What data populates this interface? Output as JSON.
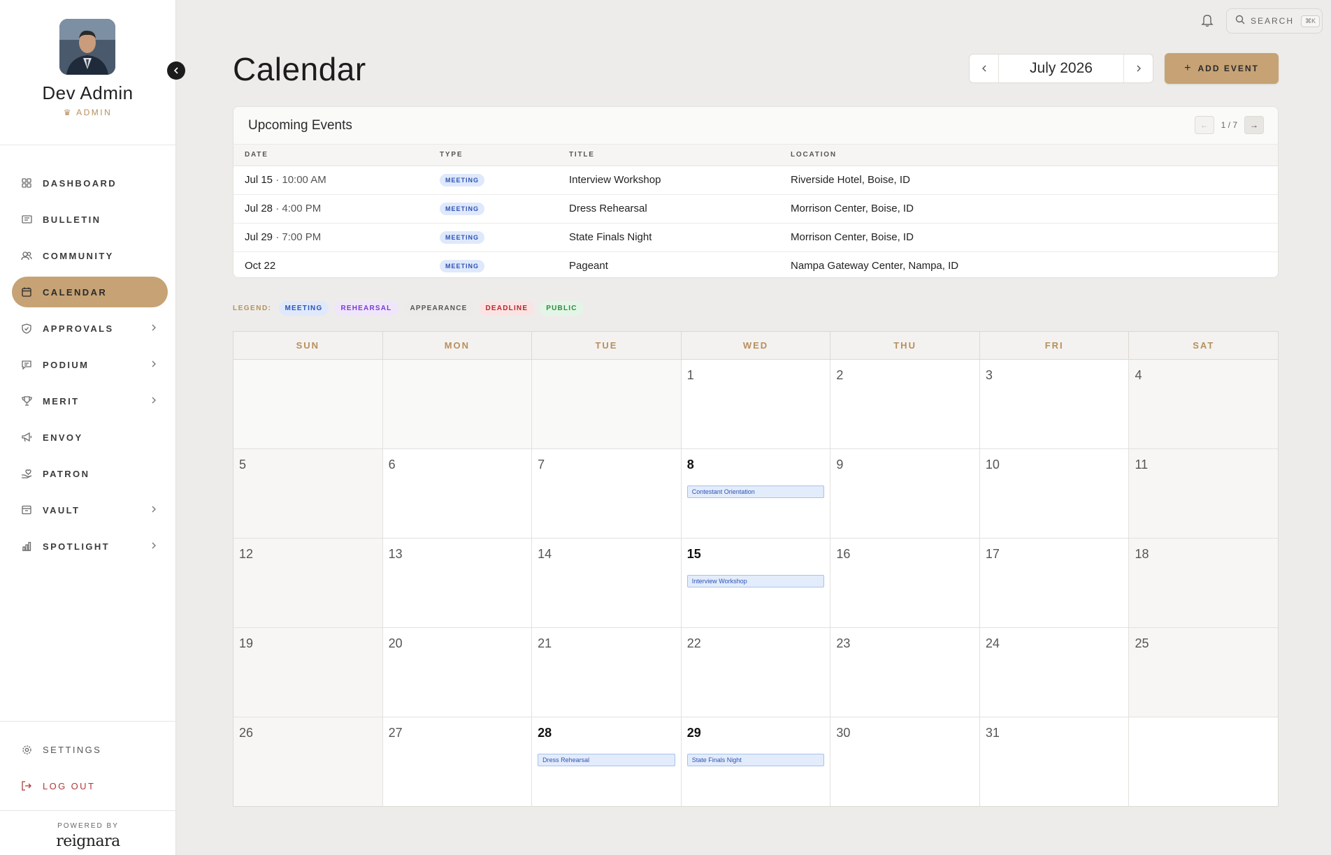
{
  "profile": {
    "name": "Dev Admin",
    "role": "ADMIN"
  },
  "nav": [
    {
      "label": "DASHBOARD",
      "icon": "grid-icon",
      "chevron": false,
      "active": false
    },
    {
      "label": "BULLETIN",
      "icon": "newspaper-icon",
      "chevron": false,
      "active": false
    },
    {
      "label": "COMMUNITY",
      "icon": "users-icon",
      "chevron": false,
      "active": false
    },
    {
      "label": "CALENDAR",
      "icon": "calendar-icon",
      "chevron": false,
      "active": true
    },
    {
      "label": "APPROVALS",
      "icon": "shield-check-icon",
      "chevron": true,
      "active": false
    },
    {
      "label": "PODIUM",
      "icon": "message-square-icon",
      "chevron": true,
      "active": false
    },
    {
      "label": "MERIT",
      "icon": "trophy-icon",
      "chevron": true,
      "active": false
    },
    {
      "label": "ENVOY",
      "icon": "megaphone-icon",
      "chevron": false,
      "active": false
    },
    {
      "label": "PATRON",
      "icon": "hand-heart-icon",
      "chevron": false,
      "active": false
    },
    {
      "label": "VAULT",
      "icon": "archive-icon",
      "chevron": true,
      "active": false
    },
    {
      "label": "SPOTLIGHT",
      "icon": "bar-chart-icon",
      "chevron": true,
      "active": false
    }
  ],
  "bottom_nav": {
    "settings": "SETTINGS",
    "logout": "LOG OUT"
  },
  "footer": {
    "powered_by": "POWERED BY",
    "brand": "reignara"
  },
  "topbar": {
    "search_label": "SEARCH",
    "search_shortcut": "⌘K"
  },
  "page_title": "Calendar",
  "month_label": "July 2026",
  "add_event_label": "ADD EVENT",
  "upcoming": {
    "title": "Upcoming Events",
    "pager": "1 / 7",
    "columns": [
      "DATE",
      "TYPE",
      "TITLE",
      "LOCATION"
    ],
    "rows": [
      {
        "date": "Jul 15",
        "time": " · 10:00 AM",
        "type": "MEETING",
        "title": "Interview Workshop",
        "location": "Riverside Hotel, Boise, ID"
      },
      {
        "date": "Jul 28",
        "time": " · 4:00 PM",
        "type": "MEETING",
        "title": "Dress Rehearsal",
        "location": "Morrison Center, Boise, ID"
      },
      {
        "date": "Jul 29",
        "time": " · 7:00 PM",
        "type": "MEETING",
        "title": "State Finals Night",
        "location": "Morrison Center, Boise, ID"
      },
      {
        "date": "Oct 22",
        "time": "",
        "type": "MEETING",
        "title": "Pageant",
        "location": "Nampa Gateway Center, Nampa, ID"
      }
    ]
  },
  "legend": {
    "label": "LEGEND:",
    "items": [
      "MEETING",
      "REHEARSAL",
      "APPEARANCE",
      "DEADLINE",
      "PUBLIC"
    ]
  },
  "calendar": {
    "weekdays": [
      "SUN",
      "MON",
      "TUE",
      "WED",
      "THU",
      "FRI",
      "SAT"
    ],
    "weeks": [
      [
        null,
        null,
        null,
        {
          "d": "1"
        },
        {
          "d": "2"
        },
        {
          "d": "3"
        },
        {
          "d": "4"
        }
      ],
      [
        {
          "d": "5"
        },
        {
          "d": "6"
        },
        {
          "d": "7"
        },
        {
          "d": "8",
          "bold": true,
          "event": "Contestant Orientation"
        },
        {
          "d": "9"
        },
        {
          "d": "10"
        },
        {
          "d": "11"
        }
      ],
      [
        {
          "d": "12"
        },
        {
          "d": "13"
        },
        {
          "d": "14"
        },
        {
          "d": "15",
          "bold": true,
          "event": "Interview Workshop"
        },
        {
          "d": "16"
        },
        {
          "d": "17"
        },
        {
          "d": "18"
        }
      ],
      [
        {
          "d": "19"
        },
        {
          "d": "20"
        },
        {
          "d": "21"
        },
        {
          "d": "22"
        },
        {
          "d": "23"
        },
        {
          "d": "24"
        },
        {
          "d": "25"
        }
      ],
      [
        {
          "d": "26"
        },
        {
          "d": "27"
        },
        {
          "d": "28",
          "bold": true,
          "event": "Dress Rehearsal"
        },
        {
          "d": "29",
          "bold": true,
          "event": "State Finals Night"
        },
        {
          "d": "30"
        },
        {
          "d": "31"
        },
        null
      ]
    ]
  },
  "colors": {
    "accent": "#c6a275",
    "meeting": "#2d52b5",
    "logout": "#b03838"
  }
}
